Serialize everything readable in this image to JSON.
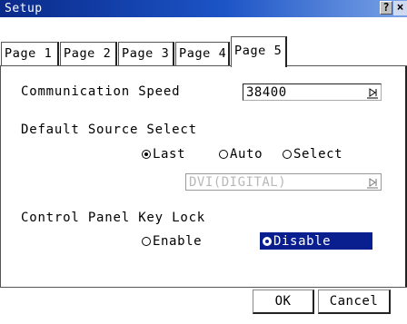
{
  "window": {
    "title": "Setup",
    "help_label": "?",
    "close_label": "×"
  },
  "tabs": [
    {
      "label": "Page 1",
      "active": false
    },
    {
      "label": "Page 2",
      "active": false
    },
    {
      "label": "Page 3",
      "active": false
    },
    {
      "label": "Page 4",
      "active": false
    },
    {
      "label": "Page 5",
      "active": true
    }
  ],
  "communication_speed": {
    "label": "Communication Speed",
    "value": "38400"
  },
  "default_source_select": {
    "label": "Default Source Select",
    "options": [
      {
        "label": "Last",
        "checked": true
      },
      {
        "label": "Auto",
        "checked": false
      },
      {
        "label": "Select",
        "checked": false
      }
    ],
    "source_value": "DVI(DIGITAL)"
  },
  "control_panel_key_lock": {
    "label": "Control Panel Key Lock",
    "options": [
      {
        "label": "Enable",
        "checked": false
      },
      {
        "label": "Disable",
        "checked": true
      }
    ]
  },
  "buttons": {
    "ok_label": "OK",
    "cancel_label": "Cancel"
  },
  "colors": {
    "title_bar": "#0a2a8a",
    "selection": "#0a1f8f",
    "disabled_text": "#b8b8b8"
  },
  "icons": {
    "combo_arrow": "dropdown-arrow-icon"
  }
}
